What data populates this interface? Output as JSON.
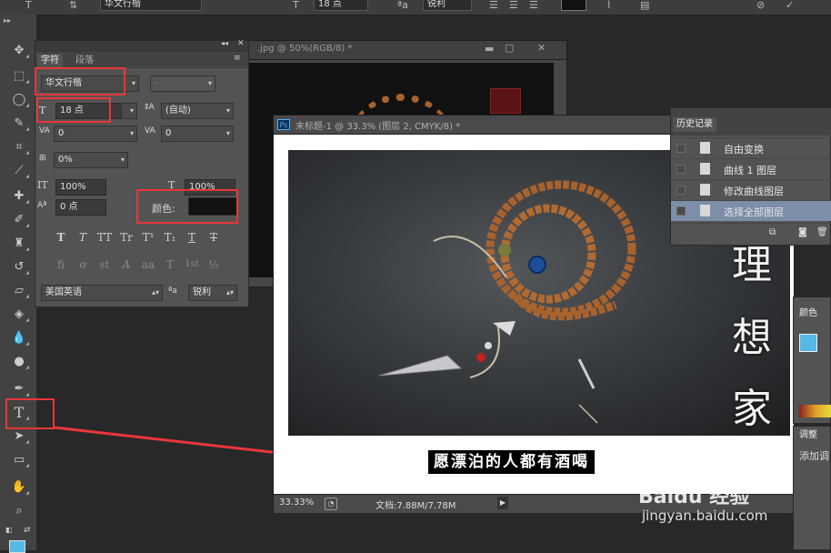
{
  "options_bar": {
    "font_family": "华文行楷",
    "font_size": "18 点",
    "antialias": "锐利"
  },
  "character_panel": {
    "tabs": [
      "字符",
      "段落"
    ],
    "font_family": "华文行楷",
    "font_style": "-",
    "font_size": "18 点",
    "leading": "(自动)",
    "kerning": "0",
    "tracking": "0",
    "tsume": "0%",
    "vertical_scale": "100%",
    "horizontal_scale": "100%",
    "baseline_shift": "0 点",
    "color_label": "颜色:",
    "text_color": "#111111",
    "style_buttons": [
      "T",
      "T",
      "TT",
      "Tr",
      "T¹",
      "T₁",
      "T",
      "T"
    ],
    "opentype_buttons": [
      "fi",
      "ơ",
      "st",
      "A",
      "aa",
      "T",
      "1st",
      "½"
    ],
    "language": "美国英语",
    "aa_label": "ªa",
    "antialias": "锐利"
  },
  "doc_back": {
    "title": ".jpg @ 50%(RGB/8) *"
  },
  "doc_front": {
    "ps_badge": "Ps",
    "title": "未标题-1 @ 33.3% (图层 2, CMYK/8) *",
    "vertical_text": [
      "理",
      "想",
      "家"
    ],
    "caption": "愿漂泊的人都有酒喝",
    "zoom": "33.33%",
    "doc_size": "文档:7.88M/7.78M"
  },
  "history_panel": {
    "tab": "历史记录",
    "items": [
      {
        "label": "自由变换",
        "selected": false
      },
      {
        "label": "曲线 1 图层",
        "selected": false
      },
      {
        "label": "修改曲线图层",
        "selected": false
      },
      {
        "label": "选择全部图层",
        "selected": true
      }
    ]
  },
  "color_panel": {
    "tab": "颜色",
    "swatch": "#55b8e6"
  },
  "adjust_panel": {
    "tab": "调整",
    "add_label": "添加调"
  },
  "watermark": {
    "brand": "Baidu 经验",
    "url": "jingyan.baidu.com"
  },
  "colors": {
    "highlight": "#e8363a",
    "panel": "#535353",
    "toolbox": "#424242"
  }
}
